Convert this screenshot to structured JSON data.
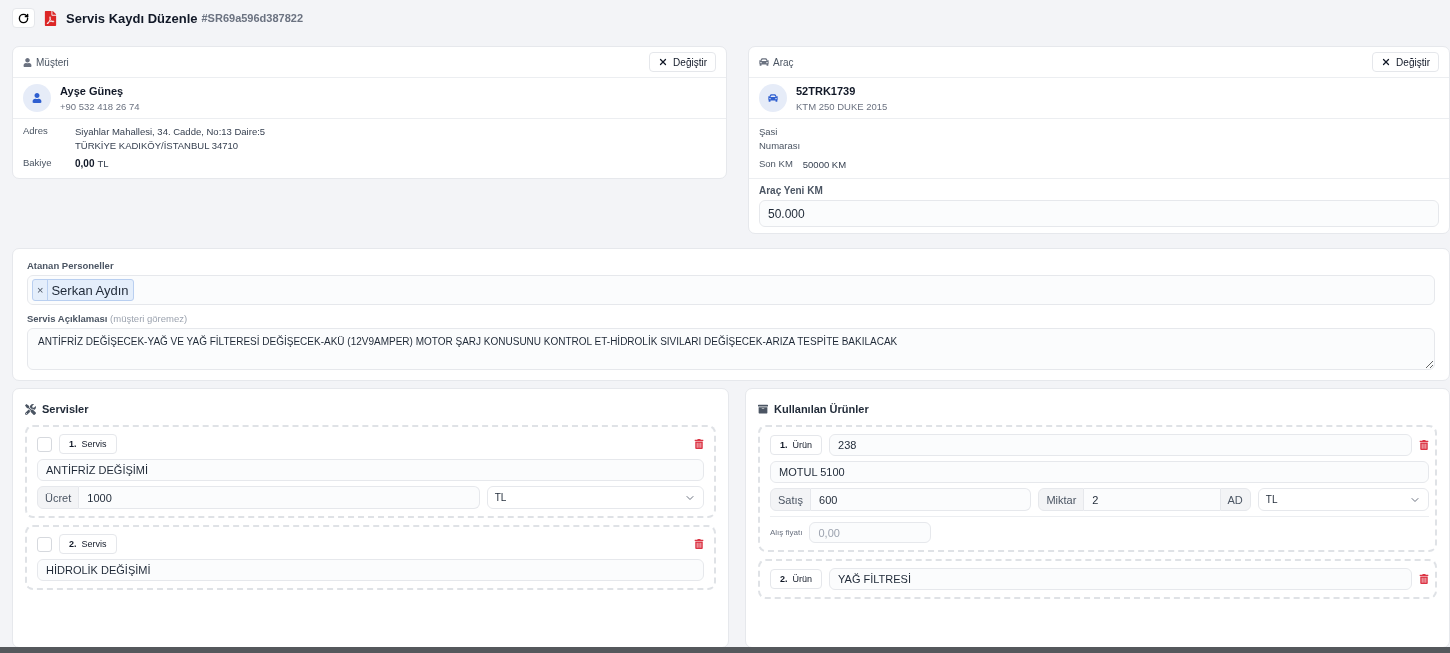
{
  "toolbar": {
    "title": "Servis Kaydı Düzenle",
    "record_id": "#SR69a596d387822"
  },
  "customer": {
    "heading": "Müşteri",
    "change_button": "Değiştir",
    "name": "Ayşe Güneş",
    "phone": "+90 532 418 26 74",
    "address_label": "Adres",
    "address_lines": [
      "Siyahlar Mahallesi, 34. Cadde, No:13 Daire:5",
      "TÜRKİYE KADIKÖY/İSTANBUL 34710"
    ],
    "balance_label": "Bakiye",
    "balance": "0,00",
    "balance_currency": "TL"
  },
  "vehicle": {
    "heading": "Araç",
    "change_button": "Değiştir",
    "plate": "52TRK1739",
    "model": "KTM 250 DUKE 2015",
    "chassis_label": "Şasi Numarası",
    "last_km_label": "Son KM",
    "last_km": "50000 KM",
    "new_km_label": "Araç Yeni KM",
    "new_km": "50.000"
  },
  "assignment": {
    "staff_label": "Atanan Personeller",
    "staff": [
      {
        "remove": "×",
        "name": "Serkan Aydın"
      }
    ],
    "description_label": "Servis Açıklaması",
    "description_hint": "(müşteri göremez)",
    "description": "ANTİFRİZ DEĞİŞECEK-YAĞ VE YAĞ FİLTERESİ DEĞİŞECEK-AKÜ (12V9AMPER) MOTOR ŞARJ KONUSUNU KONTROL ET-HİDROLİK SIVILARI DEĞİŞECEK-ARIZA TESPİTE BAKILACAK"
  },
  "services": {
    "heading": "Servisler",
    "items": [
      {
        "checked": false,
        "number": "1.",
        "tag": "Servis",
        "name": "ANTİFRİZ DEĞİŞİMİ",
        "price_label": "Ücret",
        "price": "1000",
        "currency": "TL"
      },
      {
        "checked": false,
        "number": "2.",
        "tag": "Servis",
        "name": "HİDROLİK DEĞİŞİMİ"
      }
    ]
  },
  "products": {
    "heading": "Kullanılan Ürünler",
    "items": [
      {
        "number": "1.",
        "tag": "Ürün",
        "code": "238",
        "name": "MOTUL 5100",
        "sale_label": "Satış",
        "sale": "600",
        "qty_label": "Miktar",
        "qty": "2",
        "unit": "AD",
        "currency": "TL",
        "cost_label": "Alış fiyatı",
        "cost_placeholder": "0,00"
      },
      {
        "number": "2.",
        "tag": "Ürün",
        "code": "YAĞ FİLTRESİ"
      }
    ]
  }
}
